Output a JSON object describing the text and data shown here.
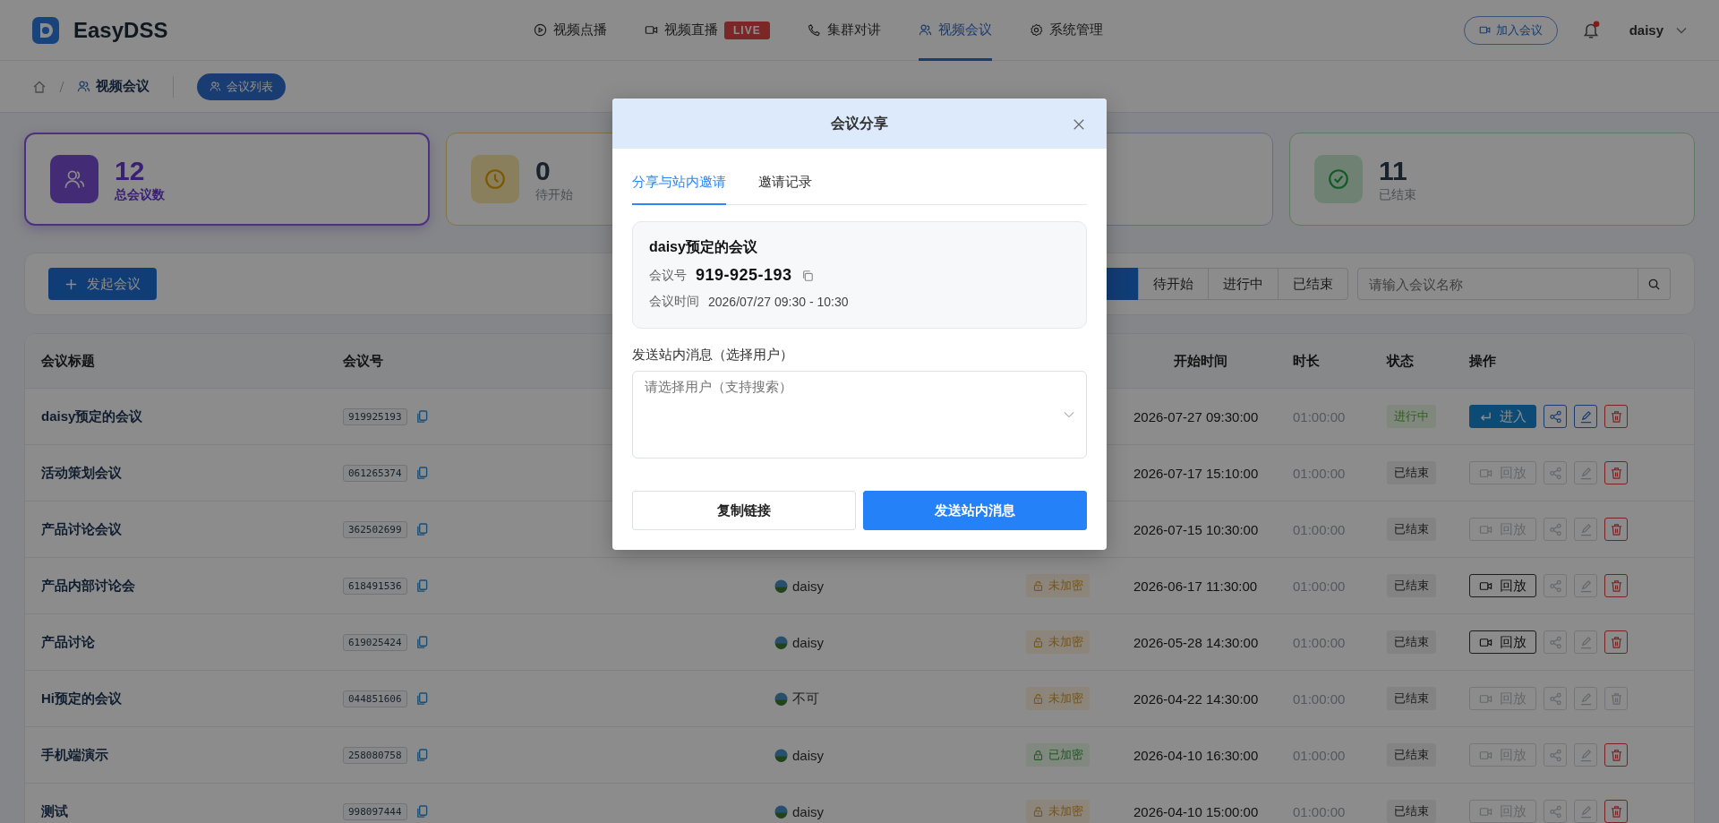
{
  "header": {
    "logo": "EasyDSS",
    "nav": [
      {
        "label": "视频点播",
        "selected": false
      },
      {
        "label": "视频直播",
        "badge": "LIVE",
        "selected": false
      },
      {
        "label": "集群对讲",
        "selected": false
      },
      {
        "label": "视频会议",
        "selected": true
      },
      {
        "label": "系统管理",
        "selected": false
      }
    ],
    "join_button": "加入会议",
    "notifications_unread": true,
    "user": "daisy"
  },
  "breadcrumb": {
    "items": [
      "视频会议"
    ],
    "current": "会议列表"
  },
  "stats": [
    {
      "kind": "total",
      "value": "12",
      "label": "总会议数",
      "selected": true
    },
    {
      "kind": "pending",
      "value": "0",
      "label": "待开始",
      "selected": false
    },
    {
      "kind": "ongoing",
      "selected": false
    },
    {
      "kind": "ended",
      "value": "11",
      "label": "已结束",
      "selected": false
    }
  ],
  "toolbar": {
    "create_button": "发起会议",
    "filters": [
      {
        "selected": true
      },
      {
        "label": "待开始",
        "selected": false
      },
      {
        "label": "进行中",
        "selected": false
      },
      {
        "label": "已结束",
        "selected": false
      }
    ],
    "search": {
      "placeholder": "请输入会议名称"
    }
  },
  "table": {
    "columns": {
      "title": "会议标题",
      "number": "会议号",
      "start": "开始时间",
      "duration": "时长",
      "status": "状态",
      "actions": "操作"
    },
    "rows": [
      {
        "title": "daisy预定的会议",
        "number": "919925193",
        "start": "2026-07-27 09:30:00",
        "duration": "01:00:00",
        "status": {
          "label": "进行中",
          "kind": "ongoing"
        },
        "actions": [
          {
            "kind": "enter",
            "label": "进入",
            "disabled": false
          },
          {
            "kind": "share",
            "disabled": false
          },
          {
            "kind": "edit",
            "disabled": false
          },
          {
            "kind": "delete",
            "disabled": false
          }
        ]
      },
      {
        "title": "活动策划会议",
        "number": "061265374",
        "start": "2026-07-17 15:10:00",
        "duration": "01:00:00",
        "status": {
          "label": "已结束",
          "kind": "ended"
        },
        "actions": [
          {
            "kind": "replay",
            "label": "回放",
            "disabled": true
          },
          {
            "kind": "share",
            "disabled": true
          },
          {
            "kind": "edit",
            "disabled": true
          },
          {
            "kind": "delete",
            "disabled": false
          }
        ]
      },
      {
        "title": "产品讨论会议",
        "number": "362502699",
        "start": "2026-07-15 10:30:00",
        "duration": "01:00:00",
        "status": {
          "label": "已结束",
          "kind": "ended"
        },
        "actions": [
          {
            "kind": "replay",
            "label": "回放",
            "disabled": true
          },
          {
            "kind": "share",
            "disabled": true
          },
          {
            "kind": "edit",
            "disabled": true
          },
          {
            "kind": "delete",
            "disabled": false
          }
        ]
      },
      {
        "title": "产品内部讨论会",
        "number": "618491536",
        "creator": "daisy",
        "encryption": {
          "label": "未加密",
          "locked": false
        },
        "start": "2026-06-17 11:30:00",
        "duration": "01:00:00",
        "status": {
          "label": "已结束",
          "kind": "ended"
        },
        "actions": [
          {
            "kind": "replay",
            "label": "回放",
            "disabled": false
          },
          {
            "kind": "share",
            "disabled": true
          },
          {
            "kind": "edit",
            "disabled": true
          },
          {
            "kind": "delete",
            "disabled": false
          }
        ]
      },
      {
        "title": "产品讨论",
        "number": "619025424",
        "creator": "daisy",
        "encryption": {
          "label": "未加密",
          "locked": false
        },
        "start": "2026-05-28 14:30:00",
        "duration": "01:00:00",
        "status": {
          "label": "已结束",
          "kind": "ended"
        },
        "actions": [
          {
            "kind": "replay",
            "label": "回放",
            "disabled": false
          },
          {
            "kind": "share",
            "disabled": true
          },
          {
            "kind": "edit",
            "disabled": true
          },
          {
            "kind": "delete",
            "disabled": false
          }
        ]
      },
      {
        "title": "Hi预定的会议",
        "number": "044851606",
        "creator": "不可",
        "encryption": {
          "label": "未加密",
          "locked": false
        },
        "start": "2026-04-22 14:30:00",
        "duration": "01:00:00",
        "status": {
          "label": "已结束",
          "kind": "ended"
        },
        "actions": [
          {
            "kind": "replay",
            "label": "回放",
            "disabled": true
          },
          {
            "kind": "share",
            "disabled": true
          },
          {
            "kind": "edit",
            "disabled": true
          },
          {
            "kind": "delete",
            "disabled": true
          }
        ]
      },
      {
        "title": "手机端演示",
        "number": "258080758",
        "creator": "daisy",
        "encryption": {
          "label": "已加密",
          "locked": true
        },
        "start": "2026-04-10 16:30:00",
        "duration": "01:00:00",
        "status": {
          "label": "已结束",
          "kind": "ended"
        },
        "actions": [
          {
            "kind": "replay",
            "label": "回放",
            "disabled": true
          },
          {
            "kind": "share",
            "disabled": true
          },
          {
            "kind": "edit",
            "disabled": true
          },
          {
            "kind": "delete",
            "disabled": false
          }
        ]
      },
      {
        "title": "测试",
        "number": "998097444",
        "creator": "daisy",
        "encryption": {
          "label": "未加密",
          "locked": false
        },
        "start": "2026-04-10 15:00:00",
        "duration": "01:00:00",
        "status": {
          "label": "已结束",
          "kind": "ended"
        },
        "actions": [
          {
            "kind": "replay",
            "label": "回放",
            "disabled": true
          },
          {
            "kind": "share",
            "disabled": true
          },
          {
            "kind": "edit",
            "disabled": true
          },
          {
            "kind": "delete",
            "disabled": false
          }
        ]
      }
    ]
  },
  "modal": {
    "title": "会议分享",
    "tabs": [
      {
        "label": "分享与站内邀请",
        "selected": true
      },
      {
        "label": "邀请记录",
        "selected": false
      }
    ],
    "meeting": {
      "title": "daisy预定的会议",
      "number_label": "会议号",
      "number": "919-925-193",
      "time_label": "会议时间",
      "time": "2026/07/27 09:30 - 10:30"
    },
    "recipients_label": "发送站内消息（选择用户）",
    "recipients": {
      "placeholder": "请选择用户（支持搜索）"
    },
    "buttons": [
      {
        "label": "复制链接",
        "kind": "secondary"
      },
      {
        "label": "发送站内消息",
        "kind": "primary"
      }
    ]
  }
}
